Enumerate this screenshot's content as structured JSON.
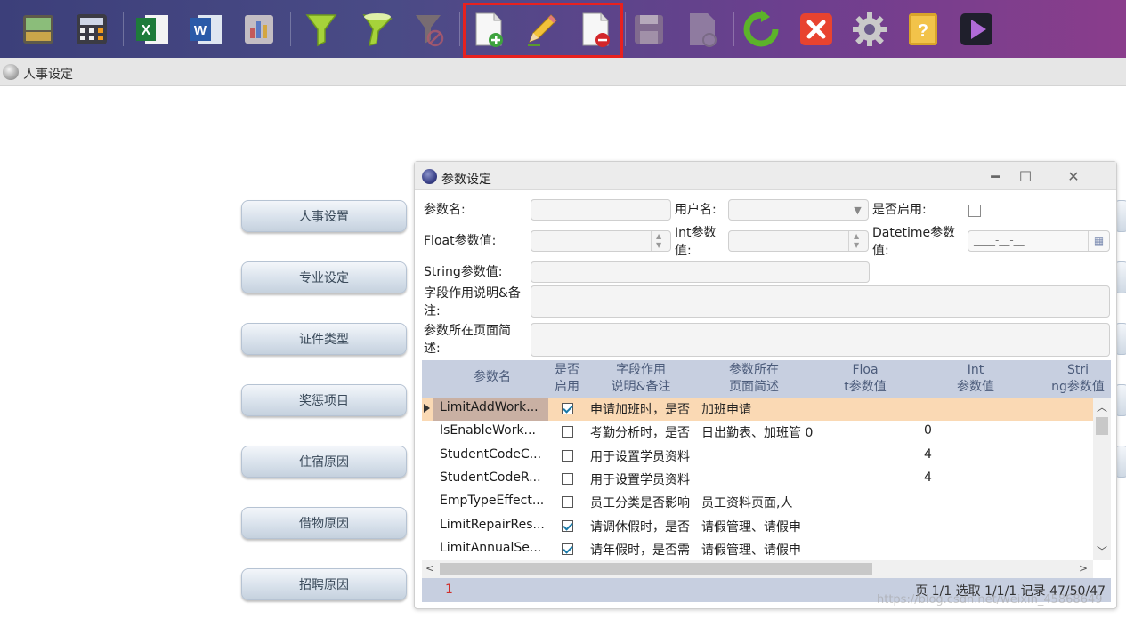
{
  "toolbar": {
    "icons": [
      "cabinet-icon",
      "calculator-icon",
      "excel-icon",
      "word-icon",
      "report-chart-icon",
      "funnel-icon",
      "funnel-clear-icon",
      "funnel-disabled-icon",
      "add-record-icon",
      "edit-record-icon",
      "delete-record-icon",
      "save-icon",
      "undo-record-icon",
      "refresh-icon",
      "close-icon",
      "settings-icon",
      "help-icon",
      "exit-icon"
    ],
    "highlight_color": "#e8211f"
  },
  "tab": {
    "label": "人事设定"
  },
  "side_buttons": [
    "人事设置",
    "专业设定",
    "证件类型",
    "奖惩项目",
    "住宿原因",
    "借物原因",
    "招聘原因"
  ],
  "dialog": {
    "title": "参数设定",
    "controls": {
      "minimize": "━",
      "maximize": "☐",
      "close": "✕"
    },
    "form": {
      "param_name_label": "参数名:",
      "user_name_label": "用户名:",
      "enabled_label": "是否启用:",
      "float_label": "Float参数值:",
      "int_label_1": "Int参数",
      "int_label_2": "值:",
      "datetime_label_1": "Datetime参数",
      "datetime_label_2": "值:",
      "datetime_placeholder": "____-__-__",
      "string_label": "String参数值:",
      "remark_label_1": "字段作用说明&备",
      "remark_label_2": "注:",
      "page_label_1": "参数所在页面简",
      "page_label_2": "述:"
    },
    "grid": {
      "headers": [
        [
          "参数名",
          ""
        ],
        [
          "是否",
          "启用"
        ],
        [
          "字段作用",
          "说明&备注"
        ],
        [
          "参数所在",
          "页面简述"
        ],
        [
          "Floa",
          "t参数值"
        ],
        [
          "Int",
          "参数值"
        ],
        [
          "Stri",
          "ng参数值"
        ]
      ],
      "rows": [
        {
          "name": "LimitAddWork...",
          "enabled": true,
          "remark": "申请加班时，是否",
          "page": "加班申请",
          "int": ""
        },
        {
          "name": "IsEnableWork...",
          "enabled": false,
          "remark": "考勤分析时，是否",
          "page": "日出勤表、加班管 0",
          "int": "0"
        },
        {
          "name": "StudentCodeC...",
          "enabled": false,
          "remark": "用于设置学员资料",
          "page": "",
          "int": "4"
        },
        {
          "name": "StudentCodeR...",
          "enabled": false,
          "remark": "用于设置学员资料",
          "page": "",
          "int": "4"
        },
        {
          "name": "EmpTypeEffect...",
          "enabled": false,
          "remark": "员工分类是否影响",
          "page": "员工资料页面,人",
          "int": ""
        },
        {
          "name": "LimitRepairRes...",
          "enabled": true,
          "remark": "请调休假时，是否",
          "page": "请假管理、请假申",
          "int": ""
        },
        {
          "name": "LimitAnnualSe...",
          "enabled": true,
          "remark": "请年假时，是否需",
          "page": "请假管理、请假申",
          "int": ""
        }
      ],
      "selected_row": 0,
      "footer": {
        "page": "1",
        "status": "页 1/1 选取 1/1/1 记录 47/50/47"
      }
    }
  },
  "watermark": "https://blog.csdn.net/weixin_45868649"
}
